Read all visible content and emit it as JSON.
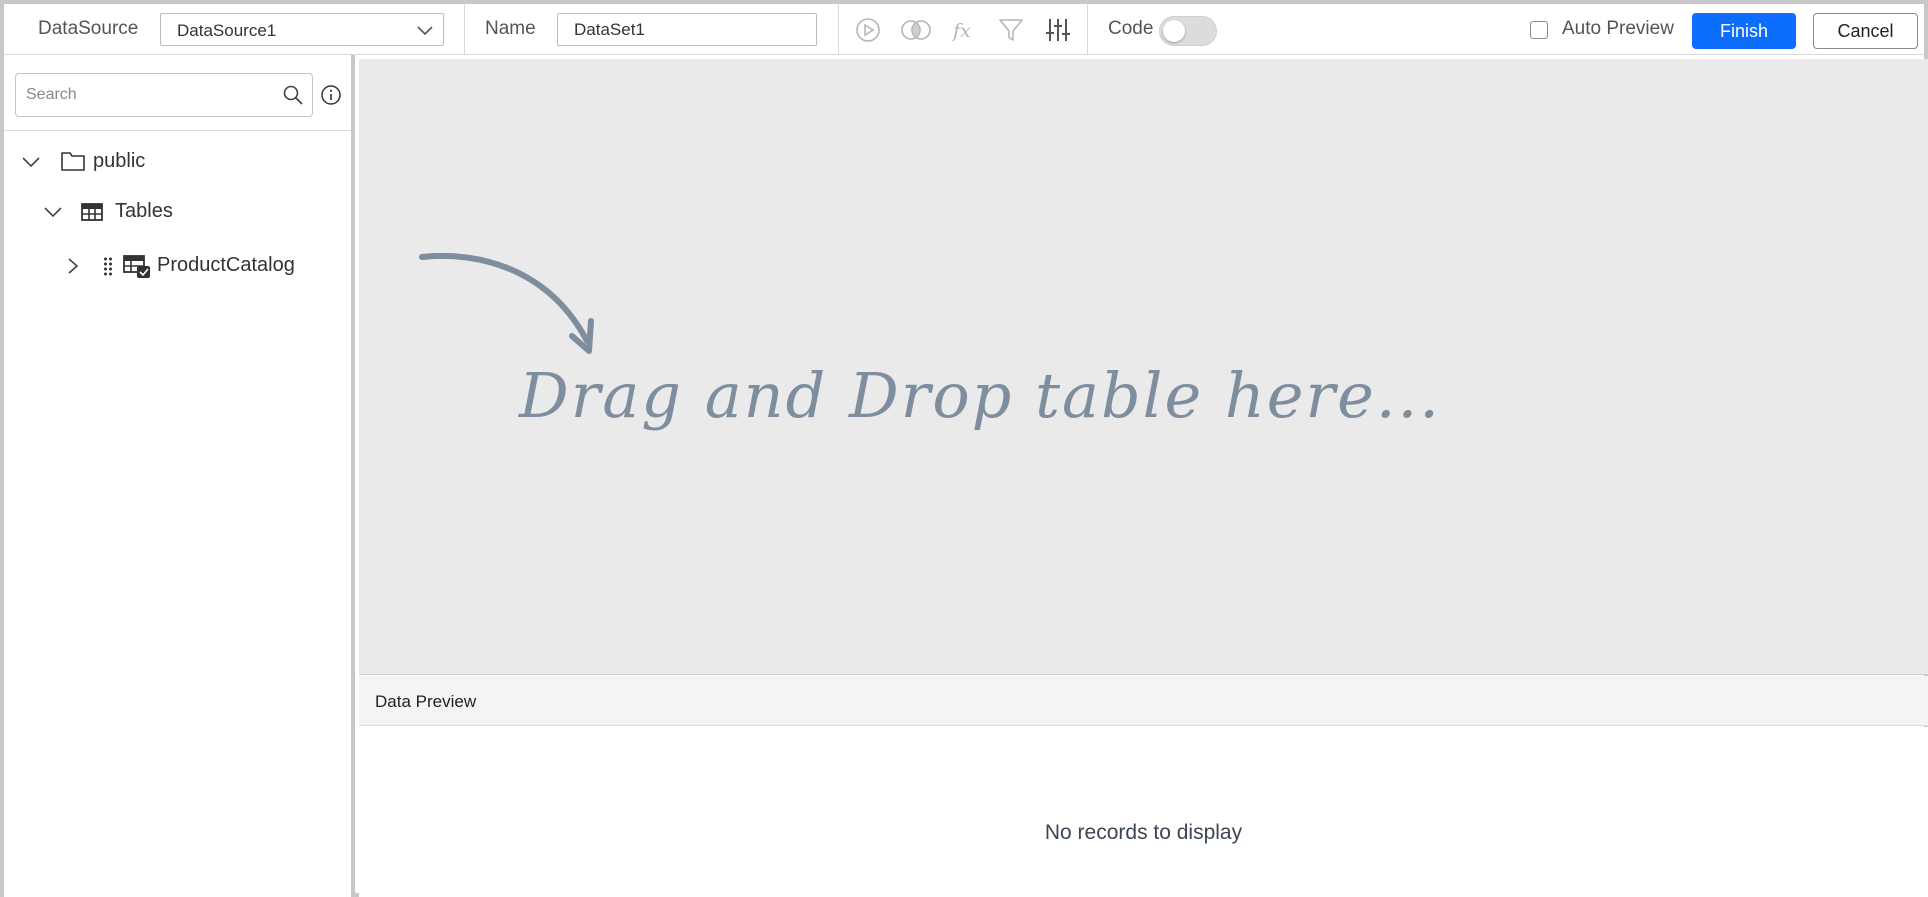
{
  "toolbar": {
    "datasource_label": "DataSource",
    "datasource_value": "DataSource1",
    "name_label": "Name",
    "name_value": "DataSet1",
    "code_label": "Code",
    "code_enabled": false,
    "auto_preview_label": "Auto Preview",
    "auto_preview_checked": false,
    "finish_label": "Finish",
    "cancel_label": "Cancel",
    "icons": [
      "run-icon",
      "join-icon",
      "expression-icon",
      "filter-icon",
      "settings-sliders-icon"
    ]
  },
  "sidebar": {
    "search_placeholder": "Search",
    "tree": {
      "schema": {
        "label": "public",
        "icon": "folder-icon",
        "expanded": true
      },
      "group": {
        "label": "Tables",
        "icon": "table-icon",
        "expanded": true
      },
      "items": [
        {
          "label": "ProductCatalog",
          "icon": "table-check-icon",
          "expanded": false
        }
      ]
    }
  },
  "canvas": {
    "drop_hint": "Drag and Drop table here..."
  },
  "preview": {
    "title": "Data Preview",
    "empty_message": "No records to display"
  },
  "colors": {
    "accent": "#0d6efd",
    "canvas_bg": "#eaeaea",
    "hint_text": "#7f8e9e"
  }
}
